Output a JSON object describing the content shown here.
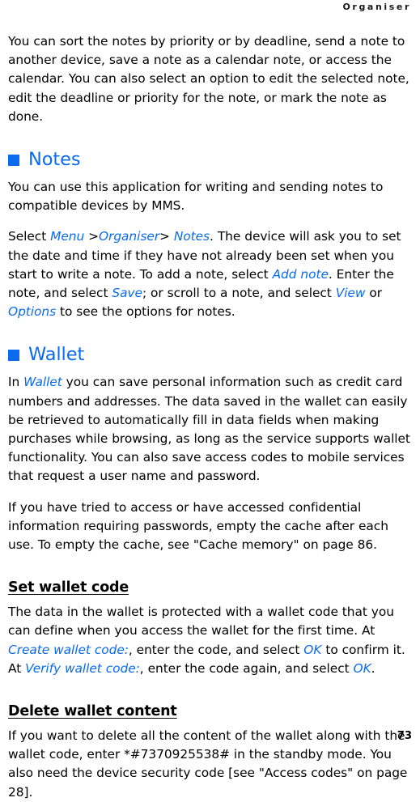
{
  "header": {
    "running_title": "Organiser"
  },
  "footer": {
    "page_number": "73"
  },
  "colors": {
    "accent_blue": "#0a6bf0",
    "text_black": "#000000",
    "background": "#ffffff"
  },
  "intro": {
    "paragraph": "You can sort the notes by priority or by deadline, send a note to another device, save a note as a calendar note, or access the calendar. You can also select an option to edit the selected note, edit the deadline or priority for the note, or mark the note as done."
  },
  "sections": [
    {
      "id": "notes",
      "bullet_icon": "blue-square-bullet",
      "title": "Notes",
      "paragraphs": [
        {
          "id": "notes-p1",
          "runs": [
            {
              "text": "You can use this application for writing and sending notes to compatible devices by MMS.",
              "style": "plain"
            }
          ]
        },
        {
          "id": "notes-p2",
          "runs": [
            {
              "text": "Select ",
              "style": "plain"
            },
            {
              "text": "Menu",
              "style": "ui"
            },
            {
              "text": " >",
              "style": "plain"
            },
            {
              "text": "Organiser",
              "style": "ui"
            },
            {
              "text": "> ",
              "style": "plain"
            },
            {
              "text": "Notes",
              "style": "ui"
            },
            {
              "text": ". The device will ask you to set the date and time if they have not already been set when you start to write a note. To add a note, select ",
              "style": "plain"
            },
            {
              "text": "Add note",
              "style": "ui"
            },
            {
              "text": ". Enter the note, and select ",
              "style": "plain"
            },
            {
              "text": "Save",
              "style": "ui"
            },
            {
              "text": "; or scroll to a note, and select ",
              "style": "plain"
            },
            {
              "text": "View",
              "style": "ui"
            },
            {
              "text": " or ",
              "style": "plain"
            },
            {
              "text": "Options",
              "style": "ui"
            },
            {
              "text": " to see the options for notes.",
              "style": "plain"
            }
          ]
        }
      ]
    },
    {
      "id": "wallet",
      "bullet_icon": "blue-square-bullet",
      "title": "Wallet",
      "paragraphs": [
        {
          "id": "wallet-p1",
          "runs": [
            {
              "text": "In ",
              "style": "plain"
            },
            {
              "text": "Wallet",
              "style": "ui"
            },
            {
              "text": " you can save personal information such as credit card numbers and addresses. The data saved in the wallet can easily be retrieved to automatically fill in data fields when making purchases while browsing, as long as the service supports wallet functionality. You can also save access codes to mobile services that request a user name and password.",
              "style": "plain"
            }
          ]
        },
        {
          "id": "wallet-p2",
          "runs": [
            {
              "text": "If you have tried to access or have accessed confidential information requiring passwords, empty the cache after each use. To empty the cache, see \"Cache memory\" on page 86.",
              "style": "plain"
            }
          ]
        }
      ],
      "subsections": [
        {
          "id": "set-wallet-code",
          "title": "Set wallet code",
          "paragraphs": [
            {
              "id": "set-wallet-code-p1",
              "runs": [
                {
                  "text": "The data in the wallet is protected with a wallet code that you can define when you access the wallet for the first time. At ",
                  "style": "plain"
                },
                {
                  "text": "Create wallet code:",
                  "style": "ui"
                },
                {
                  "text": ", enter the code, and select ",
                  "style": "plain"
                },
                {
                  "text": "OK",
                  "style": "ui"
                },
                {
                  "text": " to confirm it. At ",
                  "style": "plain"
                },
                {
                  "text": "Verify wallet code:",
                  "style": "ui"
                },
                {
                  "text": ", enter the code again, and select ",
                  "style": "plain"
                },
                {
                  "text": "OK",
                  "style": "ui"
                },
                {
                  "text": ".",
                  "style": "plain"
                }
              ]
            }
          ]
        },
        {
          "id": "delete-wallet-content",
          "title": "Delete wallet content",
          "paragraphs": [
            {
              "id": "delete-wallet-content-p1",
              "runs": [
                {
                  "text": "If you want to delete all the content of the wallet along with the wallet code, enter *#7370925538# in the standby mode. You also need the device security code [see \"Access codes\" on page 28].",
                  "style": "plain"
                }
              ]
            }
          ]
        }
      ]
    }
  ]
}
